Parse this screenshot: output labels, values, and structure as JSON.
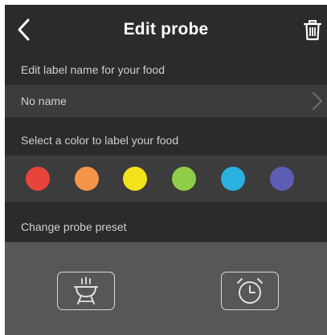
{
  "header": {
    "title": "Edit probe",
    "back_icon": "chevron-left-icon",
    "delete_icon": "trash-icon"
  },
  "label_section": {
    "heading": "Edit label name for your food",
    "value": "No name",
    "chevron_icon": "chevron-right-icon"
  },
  "color_section": {
    "heading": "Select a color to label your food",
    "colors": [
      "#e8443c",
      "#f5954a",
      "#f3e31b",
      "#8fcc48",
      "#2ab1df",
      "#5d5db5"
    ]
  },
  "preset_section": {
    "heading": "Change probe preset",
    "presets": [
      {
        "icon": "grill-icon"
      },
      {
        "icon": "alarm-clock-icon"
      }
    ]
  }
}
